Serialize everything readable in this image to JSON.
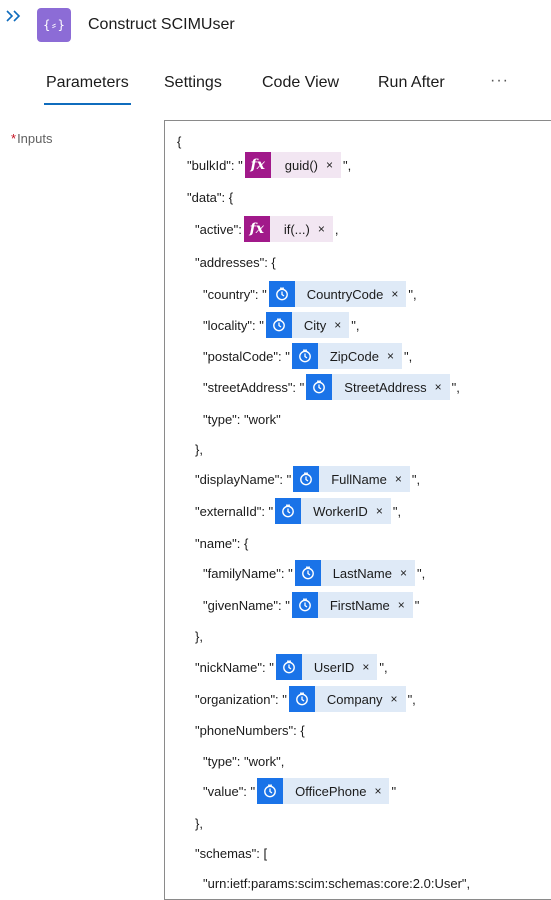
{
  "header": {
    "title": "Construct SCIMUser",
    "icon_glyph": "{⸗}"
  },
  "tabs": [
    {
      "label": "Parameters",
      "active": true
    },
    {
      "label": "Settings",
      "active": false
    },
    {
      "label": "Code View",
      "active": false
    },
    {
      "label": "Run After",
      "active": false
    }
  ],
  "more_label": "···",
  "inputs": {
    "required_mark": "*",
    "label": "Inputs"
  },
  "code": {
    "l0": "{",
    "l1_pre": "\"bulkId\": \"",
    "l1_token": "guid()",
    "l1_post": "\",",
    "l2": "\"data\": {",
    "l3_pre": "\"active\":",
    "l3_token": "if(...)",
    "l3_post": ",",
    "l4": "\"addresses\": {",
    "l5_pre": "\"country\": \"",
    "l5_token": "CountryCode",
    "l5_post": "\",",
    "l6_pre": "\"locality\": \"",
    "l6_token": "City",
    "l6_post": "\",",
    "l7_pre": "\"postalCode\": \"",
    "l7_token": "ZipCode",
    "l7_post": "\",",
    "l8_pre": "\"streetAddress\": \"",
    "l8_token": "StreetAddress",
    "l8_post": "\",",
    "l9": "\"type\": \"work\"",
    "l10": "},",
    "l11_pre": "\"displayName\": \"",
    "l11_token": "FullName",
    "l11_post": "\",",
    "l12_pre": "\"externalId\": \"",
    "l12_token": "WorkerID",
    "l12_post": "\",",
    "l13": "\"name\": {",
    "l14_pre": "\"familyName\": \"",
    "l14_token": "LastName",
    "l14_post": "\",",
    "l15_pre": "\"givenName\": \"",
    "l15_token": "FirstName",
    "l15_post": "\"",
    "l16": "},",
    "l17_pre": "\"nickName\": \"",
    "l17_token": "UserID",
    "l17_post": "\",",
    "l18_pre": "\"organization\": \"",
    "l18_token": "Company",
    "l18_post": "\",",
    "l19": "\"phoneNumbers\": {",
    "l20": "\"type\": \"work\",",
    "l21_pre": "\"value\": \"",
    "l21_token": "OfficePhone",
    "l21_post": "\"",
    "l22": "},",
    "l23": "\"schemas\": [",
    "l24": "\"urn:ietf:params:scim:schemas:core:2.0:User\","
  },
  "token_remove_glyph": "×",
  "fx_glyph": "fx",
  "colors": {
    "accent": "#0f6cbd",
    "action_icon": "#8c6cd6",
    "dynamic_token_icon": "#1a73e8",
    "dynamic_token_bg": "#dfeaf7",
    "function_token_icon": "#a1198a",
    "required": "#c50f1f"
  }
}
